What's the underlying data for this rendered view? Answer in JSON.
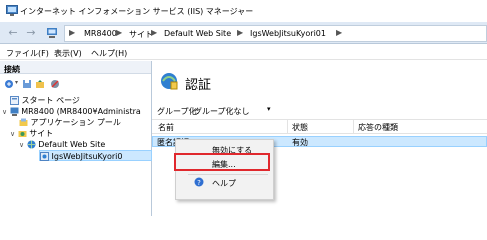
{
  "window": {
    "title": "インターネット インフォメーション サービス (IIS) マネージャー"
  },
  "address_bar": {
    "crumbs": [
      "MR8400",
      "サイト",
      "Default Web Site",
      "IgsWebJitsuKyori01"
    ],
    "back_icon": "back-arrow-icon",
    "forward_icon": "forward-arrow-icon"
  },
  "menu": {
    "items": [
      "ファイル(F)",
      "表示(V)",
      "ヘルプ(H)"
    ]
  },
  "connections": {
    "label": "接続",
    "tree": [
      {
        "label": "スタート ページ",
        "icon": "start-page-icon"
      },
      {
        "label": "MR8400 (MR8400¥Administra",
        "icon": "server-icon"
      },
      {
        "label": "アプリケーション プール",
        "icon": "app-pool-icon"
      },
      {
        "label": "サイト",
        "icon": "sites-folder-icon"
      },
      {
        "label": "Default Web Site",
        "icon": "globe-icon"
      },
      {
        "label": "IgsWebJitsuKyori0",
        "icon": "app-icon"
      }
    ]
  },
  "main": {
    "title": "認証",
    "group_label": "グループ化:",
    "group_value": "グループ化なし",
    "columns": [
      "名前",
      "状態",
      "応答の種類"
    ],
    "rows": [
      {
        "name": "匿名認証",
        "status": "有効",
        "response": ""
      }
    ]
  },
  "context_menu": {
    "items": [
      "無効にする",
      "編集...",
      "ヘルプ"
    ]
  },
  "colors": {
    "selection": "#cce8ff",
    "highlight": "#e0282d",
    "address_bar": "#dfe9f5"
  }
}
